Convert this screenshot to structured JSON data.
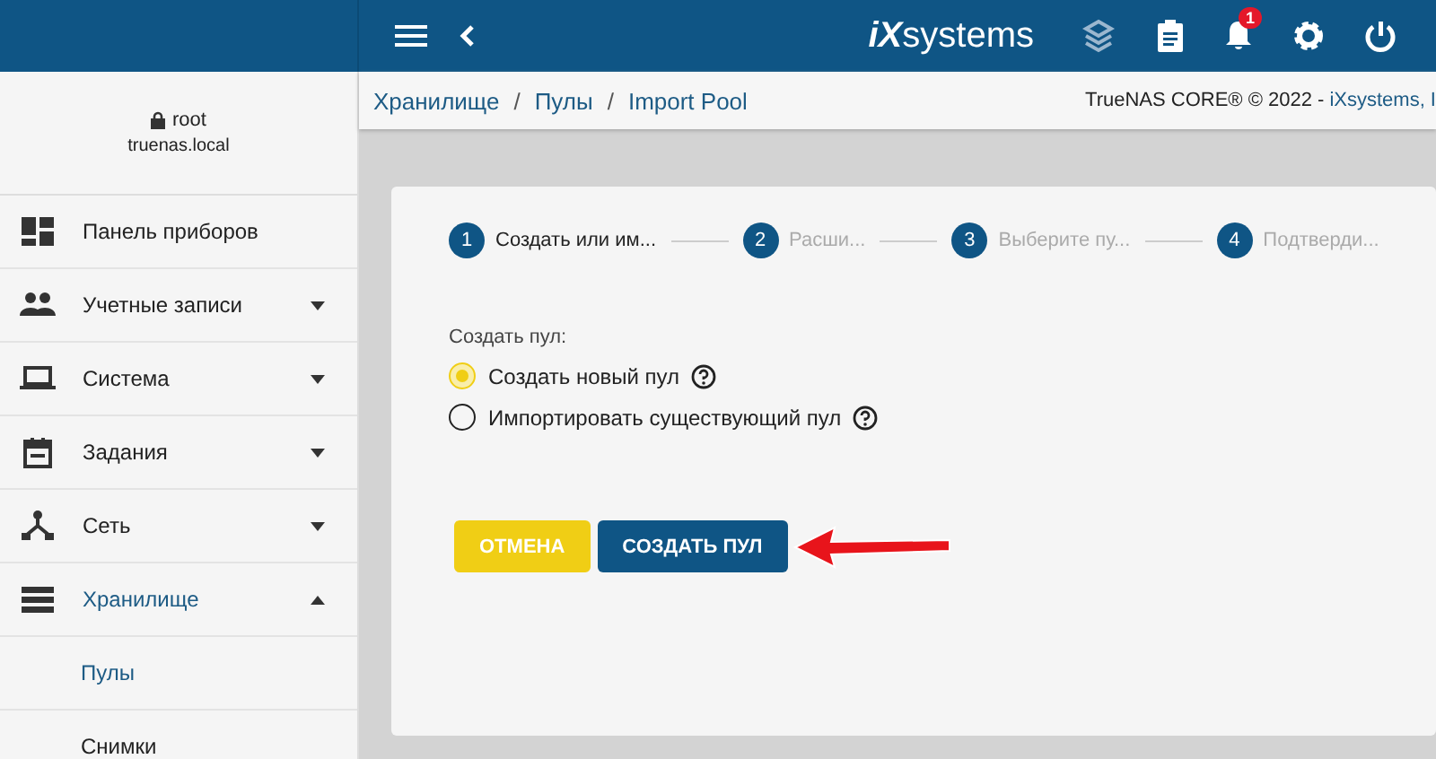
{
  "topbar": {
    "logo_mark": "iX",
    "logo_word": "systems",
    "notifications": "1"
  },
  "sidebar": {
    "user": "root",
    "host": "truenas.local",
    "items": [
      {
        "label": "Панель приборов",
        "selected": false
      },
      {
        "label": "Учетные записи",
        "selected": false,
        "expanded": false
      },
      {
        "label": "Система",
        "selected": false,
        "expanded": false
      },
      {
        "label": "Задания",
        "selected": false,
        "expanded": false
      },
      {
        "label": "Сеть",
        "selected": false,
        "expanded": false
      },
      {
        "label": "Хранилище",
        "selected": true,
        "expanded": true,
        "children": [
          {
            "label": "Пулы",
            "selected": true
          },
          {
            "label": "Снимки",
            "selected": false
          }
        ]
      }
    ]
  },
  "breadcrumbs": [
    {
      "kind": "link",
      "text": "Хранилище"
    },
    {
      "kind": "separator",
      "text": "/"
    },
    {
      "kind": "link",
      "text": "Пулы"
    },
    {
      "kind": "separator",
      "text": "/"
    },
    {
      "kind": "link",
      "text": "Import Pool"
    }
  ],
  "footer": {
    "text": "TrueNAS CORE® © 2022 -",
    "link": "iXsystems, I"
  },
  "stepper": [
    {
      "number": "1",
      "label": "Создать или им...",
      "active": true
    },
    {
      "number": "2",
      "label": "Расши...",
      "active": false
    },
    {
      "number": "3",
      "label": "Выберите пу...",
      "active": false
    },
    {
      "number": "4",
      "label": "Подтверди...",
      "active": false
    }
  ],
  "form": {
    "label": "Создать пул:",
    "options": [
      {
        "label": "Создать новый пул",
        "selected": true
      },
      {
        "label": "Импортировать существующий пул",
        "selected": false
      }
    ]
  },
  "buttons": [
    {
      "kind": "cancel",
      "label": "ОТМЕНА"
    },
    {
      "kind": "submit",
      "label": "СОЗДАТЬ ПУЛ"
    }
  ]
}
